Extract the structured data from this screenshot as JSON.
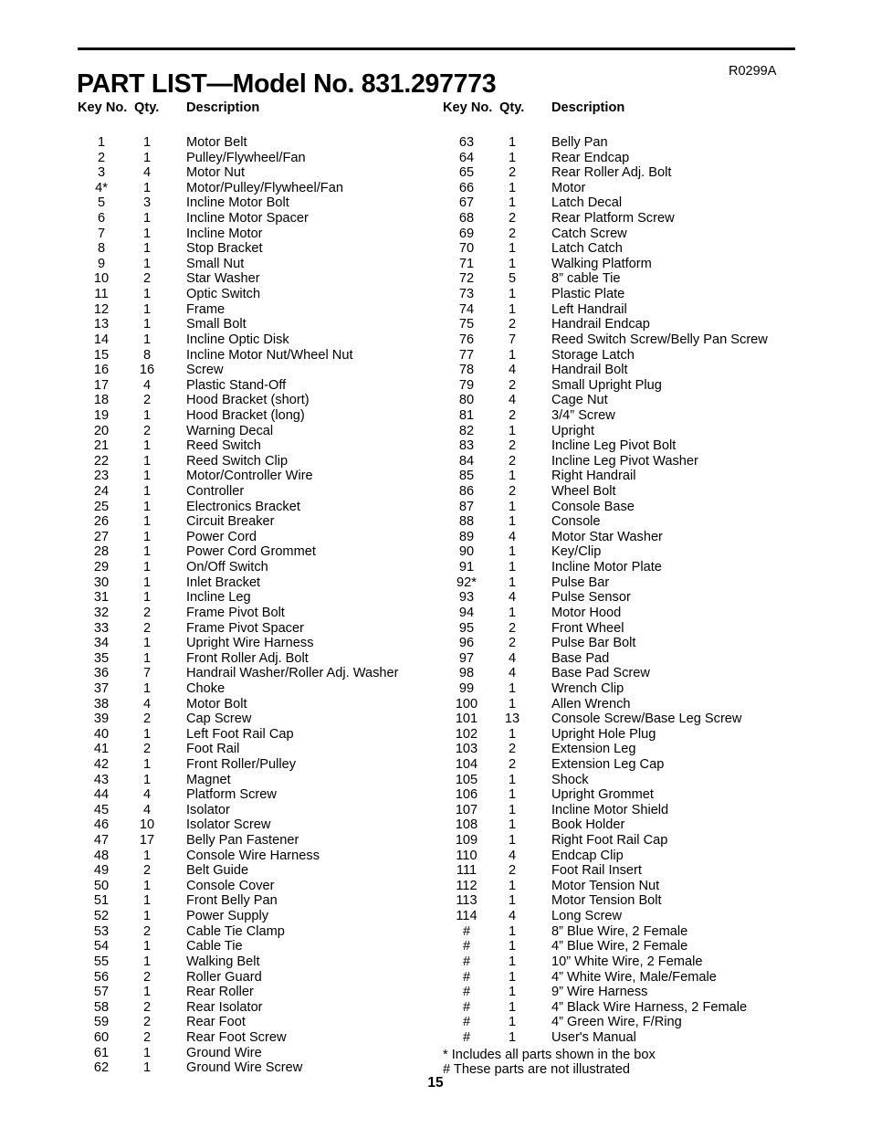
{
  "header": {
    "title": "PART LIST—Model No. 831.297773",
    "revision": "R0299A"
  },
  "columns": {
    "headers": {
      "key_no": "Key No.",
      "qty": "Qty.",
      "description": "Description"
    }
  },
  "left_rows": [
    {
      "key": "1",
      "qty": "1",
      "desc": "Motor Belt"
    },
    {
      "key": "2",
      "qty": "1",
      "desc": "Pulley/Flywheel/Fan"
    },
    {
      "key": "3",
      "qty": "4",
      "desc": "Motor Nut"
    },
    {
      "key": "4*",
      "qty": "1",
      "desc": "Motor/Pulley/Flywheel/Fan"
    },
    {
      "key": "5",
      "qty": "3",
      "desc": "Incline Motor Bolt"
    },
    {
      "key": "6",
      "qty": "1",
      "desc": "Incline Motor Spacer"
    },
    {
      "key": "7",
      "qty": "1",
      "desc": "Incline Motor"
    },
    {
      "key": "8",
      "qty": "1",
      "desc": "Stop Bracket"
    },
    {
      "key": "9",
      "qty": "1",
      "desc": "Small Nut"
    },
    {
      "key": "10",
      "qty": "2",
      "desc": "Star Washer"
    },
    {
      "key": "11",
      "qty": "1",
      "desc": "Optic Switch"
    },
    {
      "key": "12",
      "qty": "1",
      "desc": "Frame"
    },
    {
      "key": "13",
      "qty": "1",
      "desc": "Small Bolt"
    },
    {
      "key": "14",
      "qty": "1",
      "desc": "Incline Optic Disk"
    },
    {
      "key": "15",
      "qty": "8",
      "desc": "Incline Motor Nut/Wheel Nut"
    },
    {
      "key": "16",
      "qty": "16",
      "desc": "Screw"
    },
    {
      "key": "17",
      "qty": "4",
      "desc": "Plastic Stand-Off"
    },
    {
      "key": "18",
      "qty": "2",
      "desc": "Hood Bracket (short)"
    },
    {
      "key": "19",
      "qty": "1",
      "desc": "Hood Bracket (long)"
    },
    {
      "key": "20",
      "qty": "2",
      "desc": "Warning Decal"
    },
    {
      "key": "21",
      "qty": "1",
      "desc": "Reed Switch"
    },
    {
      "key": "22",
      "qty": "1",
      "desc": "Reed Switch Clip"
    },
    {
      "key": "23",
      "qty": "1",
      "desc": "Motor/Controller Wire"
    },
    {
      "key": "24",
      "qty": "1",
      "desc": "Controller"
    },
    {
      "key": "25",
      "qty": "1",
      "desc": "Electronics Bracket"
    },
    {
      "key": "26",
      "qty": "1",
      "desc": "Circuit Breaker"
    },
    {
      "key": "27",
      "qty": "1",
      "desc": "Power Cord"
    },
    {
      "key": "28",
      "qty": "1",
      "desc": "Power Cord Grommet"
    },
    {
      "key": "29",
      "qty": "1",
      "desc": "On/Off Switch"
    },
    {
      "key": "30",
      "qty": "1",
      "desc": "Inlet Bracket"
    },
    {
      "key": "31",
      "qty": "1",
      "desc": "Incline Leg"
    },
    {
      "key": "32",
      "qty": "2",
      "desc": "Frame Pivot Bolt"
    },
    {
      "key": "33",
      "qty": "2",
      "desc": "Frame Pivot Spacer"
    },
    {
      "key": "34",
      "qty": "1",
      "desc": "Upright Wire Harness"
    },
    {
      "key": "35",
      "qty": "1",
      "desc": "Front Roller Adj. Bolt"
    },
    {
      "key": "36",
      "qty": "7",
      "desc": "Handrail Washer/Roller Adj. Washer"
    },
    {
      "key": "37",
      "qty": "1",
      "desc": "Choke"
    },
    {
      "key": "38",
      "qty": "4",
      "desc": "Motor Bolt"
    },
    {
      "key": "39",
      "qty": "2",
      "desc": "Cap Screw"
    },
    {
      "key": "40",
      "qty": "1",
      "desc": "Left Foot Rail Cap"
    },
    {
      "key": "41",
      "qty": "2",
      "desc": "Foot Rail"
    },
    {
      "key": "42",
      "qty": "1",
      "desc": "Front Roller/Pulley"
    },
    {
      "key": "43",
      "qty": "1",
      "desc": "Magnet"
    },
    {
      "key": "44",
      "qty": "4",
      "desc": "Platform Screw"
    },
    {
      "key": "45",
      "qty": "4",
      "desc": "Isolator"
    },
    {
      "key": "46",
      "qty": "10",
      "desc": "Isolator Screw"
    },
    {
      "key": "47",
      "qty": "17",
      "desc": "Belly Pan Fastener"
    },
    {
      "key": "48",
      "qty": "1",
      "desc": "Console Wire Harness"
    },
    {
      "key": "49",
      "qty": "2",
      "desc": "Belt Guide"
    },
    {
      "key": "50",
      "qty": "1",
      "desc": "Console Cover"
    },
    {
      "key": "51",
      "qty": "1",
      "desc": "Front Belly Pan"
    },
    {
      "key": "52",
      "qty": "1",
      "desc": "Power Supply"
    },
    {
      "key": "53",
      "qty": "2",
      "desc": "Cable Tie Clamp"
    },
    {
      "key": "54",
      "qty": "1",
      "desc": "Cable Tie"
    },
    {
      "key": "55",
      "qty": "1",
      "desc": "Walking Belt"
    },
    {
      "key": "56",
      "qty": "2",
      "desc": "Roller Guard"
    },
    {
      "key": "57",
      "qty": "1",
      "desc": "Rear Roller"
    },
    {
      "key": "58",
      "qty": "2",
      "desc": "Rear Isolator"
    },
    {
      "key": "59",
      "qty": "2",
      "desc": "Rear Foot"
    },
    {
      "key": "60",
      "qty": "2",
      "desc": "Rear Foot Screw"
    },
    {
      "key": "61",
      "qty": "1",
      "desc": "Ground Wire"
    },
    {
      "key": "62",
      "qty": "1",
      "desc": "Ground Wire Screw"
    }
  ],
  "right_rows": [
    {
      "key": "63",
      "qty": "1",
      "desc": "Belly Pan"
    },
    {
      "key": "64",
      "qty": "1",
      "desc": "Rear Endcap"
    },
    {
      "key": "65",
      "qty": "2",
      "desc": "Rear Roller Adj. Bolt"
    },
    {
      "key": "66",
      "qty": "1",
      "desc": "Motor"
    },
    {
      "key": "67",
      "qty": "1",
      "desc": "Latch Decal"
    },
    {
      "key": "68",
      "qty": "2",
      "desc": "Rear Platform Screw"
    },
    {
      "key": "69",
      "qty": "2",
      "desc": "Catch Screw"
    },
    {
      "key": "70",
      "qty": "1",
      "desc": "Latch Catch"
    },
    {
      "key": "71",
      "qty": "1",
      "desc": "Walking Platform"
    },
    {
      "key": "72",
      "qty": "5",
      "desc": "8” cable Tie"
    },
    {
      "key": "73",
      "qty": "1",
      "desc": "Plastic Plate"
    },
    {
      "key": "74",
      "qty": "1",
      "desc": "Left Handrail"
    },
    {
      "key": "75",
      "qty": "2",
      "desc": "Handrail Endcap"
    },
    {
      "key": "76",
      "qty": "7",
      "desc": "Reed Switch Screw/Belly Pan Screw"
    },
    {
      "key": "77",
      "qty": "1",
      "desc": "Storage Latch"
    },
    {
      "key": "78",
      "qty": "4",
      "desc": "Handrail Bolt"
    },
    {
      "key": "79",
      "qty": "2",
      "desc": "Small Upright Plug"
    },
    {
      "key": "80",
      "qty": "4",
      "desc": "Cage Nut"
    },
    {
      "key": "81",
      "qty": "2",
      "desc": "3/4” Screw"
    },
    {
      "key": "82",
      "qty": "1",
      "desc": "Upright"
    },
    {
      "key": "83",
      "qty": "2",
      "desc": "Incline Leg Pivot Bolt"
    },
    {
      "key": "84",
      "qty": "2",
      "desc": "Incline Leg Pivot Washer"
    },
    {
      "key": "85",
      "qty": "1",
      "desc": "Right Handrail"
    },
    {
      "key": "86",
      "qty": "2",
      "desc": "Wheel Bolt"
    },
    {
      "key": "87",
      "qty": "1",
      "desc": "Console Base"
    },
    {
      "key": "88",
      "qty": "1",
      "desc": "Console"
    },
    {
      "key": "89",
      "qty": "4",
      "desc": "Motor Star Washer"
    },
    {
      "key": "90",
      "qty": "1",
      "desc": "Key/Clip"
    },
    {
      "key": "91",
      "qty": "1",
      "desc": "Incline Motor Plate"
    },
    {
      "key": "92*",
      "qty": "1",
      "desc": "Pulse Bar"
    },
    {
      "key": "93",
      "qty": "4",
      "desc": "Pulse Sensor"
    },
    {
      "key": "94",
      "qty": "1",
      "desc": "Motor Hood"
    },
    {
      "key": "95",
      "qty": "2",
      "desc": "Front Wheel"
    },
    {
      "key": "96",
      "qty": "2",
      "desc": "Pulse Bar Bolt"
    },
    {
      "key": "97",
      "qty": "4",
      "desc": "Base Pad"
    },
    {
      "key": "98",
      "qty": "4",
      "desc": "Base Pad Screw"
    },
    {
      "key": "99",
      "qty": "1",
      "desc": "Wrench Clip"
    },
    {
      "key": "100",
      "qty": "1",
      "desc": "Allen Wrench"
    },
    {
      "key": "101",
      "qty": "13",
      "desc": "Console Screw/Base Leg Screw"
    },
    {
      "key": "102",
      "qty": "1",
      "desc": "Upright Hole Plug"
    },
    {
      "key": "103",
      "qty": "2",
      "desc": "Extension Leg"
    },
    {
      "key": "104",
      "qty": "2",
      "desc": "Extension Leg Cap"
    },
    {
      "key": "105",
      "qty": "1",
      "desc": "Shock"
    },
    {
      "key": "106",
      "qty": "1",
      "desc": "Upright Grommet"
    },
    {
      "key": "107",
      "qty": "1",
      "desc": "Incline Motor Shield"
    },
    {
      "key": "108",
      "qty": "1",
      "desc": "Book Holder"
    },
    {
      "key": "109",
      "qty": "1",
      "desc": "Right Foot Rail Cap"
    },
    {
      "key": "110",
      "qty": "4",
      "desc": "Endcap Clip"
    },
    {
      "key": "111",
      "qty": "2",
      "desc": "Foot Rail Insert"
    },
    {
      "key": "112",
      "qty": "1",
      "desc": "Motor Tension Nut"
    },
    {
      "key": "113",
      "qty": "1",
      "desc": "Motor Tension Bolt"
    },
    {
      "key": "114",
      "qty": "4",
      "desc": "Long Screw"
    },
    {
      "key": "#",
      "qty": "1",
      "desc": "8” Blue Wire, 2 Female"
    },
    {
      "key": "#",
      "qty": "1",
      "desc": "4” Blue Wire, 2 Female"
    },
    {
      "key": "#",
      "qty": "1",
      "desc": "10” White Wire, 2 Female"
    },
    {
      "key": "#",
      "qty": "1",
      "desc": "4” White Wire, Male/Female"
    },
    {
      "key": "#",
      "qty": "1",
      "desc": "9” Wire Harness"
    },
    {
      "key": "#",
      "qty": "1",
      "desc": "4” Black Wire Harness, 2 Female"
    },
    {
      "key": "#",
      "qty": "1",
      "desc": "4” Green Wire, F/Ring"
    },
    {
      "key": "#",
      "qty": "1",
      "desc": "User's Manual"
    }
  ],
  "footnotes": [
    "* Includes all parts shown in the box",
    "# These parts are not illustrated"
  ],
  "footer": {
    "page_number": "15"
  }
}
